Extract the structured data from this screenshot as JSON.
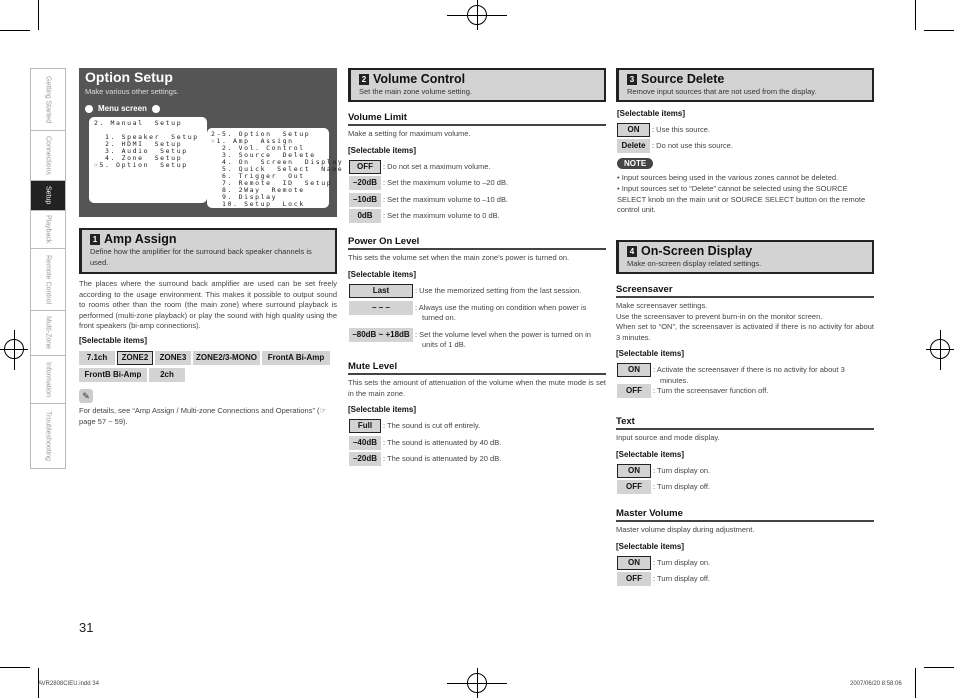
{
  "sidebar": {
    "items": [
      "Getting Started",
      "Connections",
      "Setup",
      "Playback",
      "Remote Control",
      "Multi-Zone",
      "Information",
      "Troubleshooting"
    ],
    "active": "Setup"
  },
  "option_setup": {
    "title": "Option Setup",
    "subtitle": "Make various other settings.",
    "menu_label": "Menu screen",
    "menu1": [
      "2. Manual  Setup",
      "",
      "  1. Speaker  Setup",
      "  2. HDMI  Setup",
      "  3. Audio  Setup",
      "  4. Zone  Setup",
      "☞5. Option  Setup"
    ],
    "menu2": [
      "2-5. Option  Setup",
      "☞1. Amp  Assign",
      "  2. Vol. Control",
      "  3. Source  Delete",
      "  4. On  Screen  Display",
      "  5. Quick  Select  Name",
      "  6. Trigger  Out",
      "  7. Remote  ID  Setup",
      "  8. 2Way  Remote",
      "  9. Display",
      "  10. Setup  Lock"
    ]
  },
  "amp_assign": {
    "num": "1",
    "title": "Amp Assign",
    "desc": "Define how the amplifier for the surround back speaker channels is used.",
    "body": "The places where the surround back amplifier are used can be set freely according to the usage environment. This makes it possible to output sound to rooms other than the room (the main zone) where surround playback is performed (multi-zone playback) or play the sound with high quality using the front speakers (bi-amp connections).",
    "selectable": "[Selectable items]",
    "items": [
      "7.1ch",
      "ZONE2",
      "ZONE3",
      "ZONE2/3-MONO",
      "FrontA Bi-Amp",
      "FrontB Bi-Amp",
      "2ch"
    ],
    "selected": "ZONE2",
    "note": "For details, see “Amp Assign / Multi-zone Connections and Operations” (☞page 57 ~ 59)."
  },
  "volume_control": {
    "num": "2",
    "title": "Volume Control",
    "desc": "Set the main zone volume setting.",
    "volume_limit": {
      "title": "Volume Limit",
      "desc": "Make a setting for maximum volume.",
      "selectable": "[Selectable items]",
      "items": [
        {
          "label": "OFF",
          "text": "Do not set a maximum volume."
        },
        {
          "label": "–20dB",
          "text": "Set the maximum volume to –20 dB."
        },
        {
          "label": "–10dB",
          "text": "Set the maximum volume to –10 dB."
        },
        {
          "label": "0dB",
          "text": "Set the maximum volume to 0 dB."
        }
      ]
    },
    "power_on_level": {
      "title": "Power On Level",
      "desc": "This sets the volume set when the main zone's power is turned on.",
      "selectable": "[Selectable items]",
      "items": [
        {
          "label": "Last",
          "text": "Use the memorized setting from the last session."
        },
        {
          "label": "– – –",
          "text": "Always use the muting on condition when power is turned on."
        },
        {
          "label": "–80dB ~ +18dB",
          "text": "Set the volume level when the power is turned on in units of 1 dB."
        }
      ]
    },
    "mute_level": {
      "title": "Mute Level",
      "desc": "This sets the amount of attenuation of the volume when the mute mode is set in the main zone.",
      "selectable": "[Selectable items]",
      "items": [
        {
          "label": "Full",
          "text": "The sound is cut off entirely."
        },
        {
          "label": "–40dB",
          "text": "The sound is attenuated by 40 dB."
        },
        {
          "label": "–20dB",
          "text": "The sound is attenuated by 20 dB."
        }
      ]
    }
  },
  "source_delete": {
    "num": "3",
    "title": "Source Delete",
    "desc": "Remove input sources that are not used from the display.",
    "selectable": "[Selectable items]",
    "items": [
      {
        "label": "ON",
        "text": "Use this source."
      },
      {
        "label": "Delete",
        "text": "Do not use this source."
      }
    ],
    "note_label": "NOTE",
    "notes": [
      "Input sources being used in the various zones cannot be deleted.",
      "Input sources set to “Delete” cannot be selected using the SOURCE SELECT knob on the main unit or SOURCE SELECT button on the remote control unit."
    ]
  },
  "on_screen": {
    "num": "4",
    "title": "On-Screen Display",
    "desc": "Make on-screen display related settings.",
    "screensaver": {
      "title": "Screensaver",
      "desc": "Make screensaver settings.\nUse the screensaver to prevent burn-in on the monitor screen.\nWhen set to “ON”, the screensaver is activated if there is no activity for about 3 minutes.",
      "selectable": "[Selectable items]",
      "items": [
        {
          "label": "ON",
          "text": "Activate the screensaver if there is no activity for about 3 minutes."
        },
        {
          "label": "OFF",
          "text": "Turn the screensaver function off."
        }
      ]
    },
    "text": {
      "title": "Text",
      "desc": "Input source and mode display.",
      "selectable": "[Selectable items]",
      "items": [
        {
          "label": "ON",
          "text": "Turn display on."
        },
        {
          "label": "OFF",
          "text": "Turn display off."
        }
      ]
    },
    "master_volume": {
      "title": "Master Volume",
      "desc": "Master volume display during adjustment.",
      "selectable": "[Selectable items]",
      "items": [
        {
          "label": "ON",
          "text": "Turn display on."
        },
        {
          "label": "OFF",
          "text": "Turn display off."
        }
      ]
    }
  },
  "page_number": "31",
  "footer": {
    "file": "AVR2808CIEU.indd   34",
    "timestamp": "2007/06/20   8:58:06"
  }
}
